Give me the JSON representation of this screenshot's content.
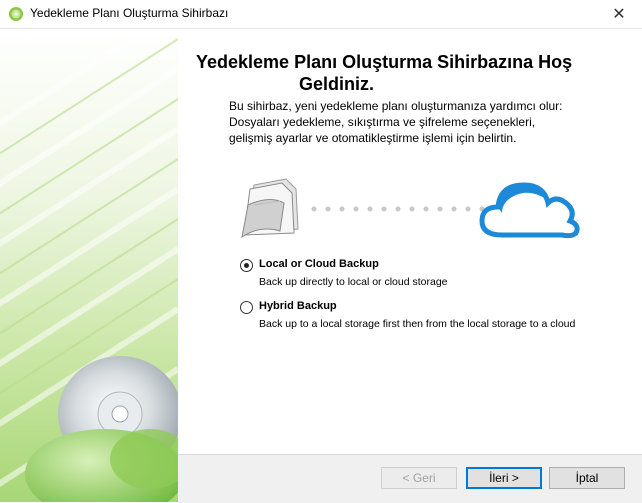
{
  "window": {
    "title": "Yedekleme Planı Oluşturma Sihirbazı",
    "close_symbol": "✕"
  },
  "content": {
    "heading_line1": "Yedekleme Planı  Oluşturma Sihirbazına Hoş",
    "heading_line2": "Geldiniz.",
    "description": "Bu sihirbaz, yeni yedekleme planı oluşturmanıza yardımcı olur: Dosyaları yedekleme, sıkıştırma ve şifreleme seçenekleri, gelişmiş ayarlar ve otomatikleştirme işlemi için belirtin."
  },
  "options": [
    {
      "title": "Local or Cloud Backup",
      "description": "Back up directly to local or cloud storage",
      "selected": true
    },
    {
      "title": "Hybrid Backup",
      "description": "Back up to a local storage first then from the local storage to a cloud",
      "selected": false
    }
  ],
  "buttons": {
    "back": "< Geri",
    "next": "İleri >",
    "cancel": "İptal"
  },
  "colors": {
    "sidebar_green": "#7cc242",
    "cloud_blue": "#1c8ad8",
    "focus_blue": "#0078d7"
  }
}
